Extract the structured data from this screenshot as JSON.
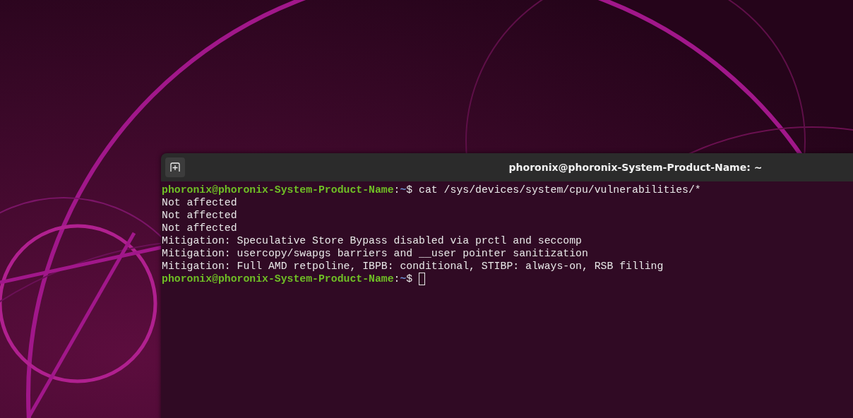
{
  "window": {
    "title": "phoronix@phoronix-System-Product-Name: ~"
  },
  "terminal": {
    "lines": [
      {
        "kind": "prompt",
        "user_host": "phoronix@phoronix-System-Product-Name",
        "separator": ":",
        "path": "~",
        "symbol": "$",
        "command": "cat /sys/devices/system/cpu/vulnerabilities/*",
        "cursor": false
      },
      {
        "kind": "output",
        "text": "Not affected"
      },
      {
        "kind": "output",
        "text": "Not affected"
      },
      {
        "kind": "output",
        "text": "Not affected"
      },
      {
        "kind": "output",
        "text": "Mitigation: Speculative Store Bypass disabled via prctl and seccomp"
      },
      {
        "kind": "output",
        "text": "Mitigation: usercopy/swapgs barriers and __user pointer sanitization"
      },
      {
        "kind": "output",
        "text": "Mitigation: Full AMD retpoline, IBPB: conditional, STIBP: always-on, RSB filling"
      },
      {
        "kind": "prompt",
        "user_host": "phoronix@phoronix-System-Product-Name",
        "separator": ":",
        "path": "~",
        "symbol": "$",
        "cursor": true
      }
    ]
  }
}
